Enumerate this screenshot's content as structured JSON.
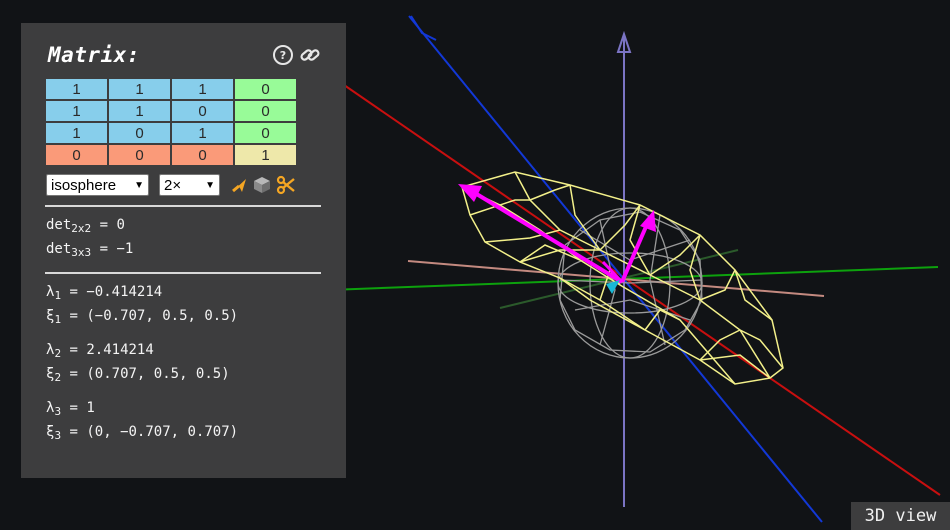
{
  "panel": {
    "title": "Matrix:",
    "matrix": [
      [
        "1",
        "1",
        "1",
        "0"
      ],
      [
        "1",
        "1",
        "0",
        "0"
      ],
      [
        "1",
        "0",
        "1",
        "0"
      ],
      [
        "0",
        "0",
        "0",
        "1"
      ]
    ],
    "shape_select": "isosphere",
    "scale_select": "2×",
    "det2_label": "det",
    "det2_sub": "2x2",
    "det2_value": " = 0",
    "det3_label": "det",
    "det3_sub": "3x3",
    "det3_value": " = −1",
    "eigen": [
      {
        "lambda_sym": "λ",
        "sub": "1",
        "lambda_value": " = −0.414214",
        "xi_sym": "ξ",
        "xi_value": " = (−0.707, 0.5, 0.5)"
      },
      {
        "lambda_sym": "λ",
        "sub": "2",
        "lambda_value": " = 2.414214",
        "xi_sym": "ξ",
        "xi_value": " = (0.707, 0.5, 0.5)"
      },
      {
        "lambda_sym": "λ",
        "sub": "3",
        "lambda_value": " = 1",
        "xi_sym": "ξ",
        "xi_value": " = (0, −0.707, 0.707)"
      }
    ],
    "icons": [
      "help-icon",
      "link-icon",
      "arrow-icon",
      "cube-icon",
      "scissors-icon"
    ]
  },
  "view_label": "3D view",
  "colors": {
    "panel_bg": "#3d3d3e",
    "scene_bg": "#111316",
    "cell_blue": "#87ceeb",
    "cell_green": "#98fb98",
    "cell_salmon": "#fa9a79",
    "cell_yellow": "#eee8aa",
    "accent_orange": "#f5a623",
    "ellipsoid": "#f3f08a",
    "sphere": "#9a9a9a",
    "eigen_vector": "#ff00ff"
  }
}
